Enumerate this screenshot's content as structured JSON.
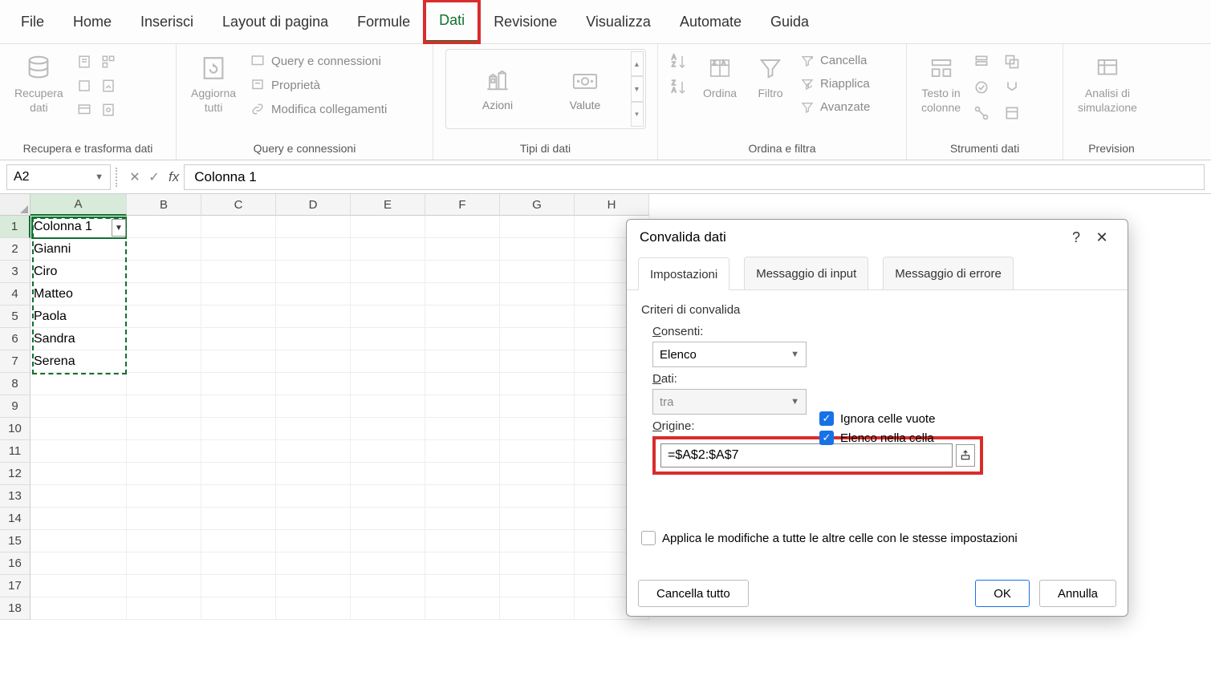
{
  "menu": {
    "items": [
      "File",
      "Home",
      "Inserisci",
      "Layout di pagina",
      "Formule",
      "Dati",
      "Revisione",
      "Visualizza",
      "Automate",
      "Guida"
    ],
    "active": "Dati"
  },
  "ribbon": {
    "groups": {
      "recupera": {
        "label": "Recupera e trasforma dati",
        "btn": "Recupera\ndati"
      },
      "aggiorna": {
        "label": "Query e connessioni",
        "btn": "Aggiorna\ntutti",
        "items": [
          "Query e connessioni",
          "Proprietà",
          "Modifica collegamenti"
        ]
      },
      "tipi": {
        "label": "Tipi di dati",
        "items": [
          "Azioni",
          "Valute"
        ]
      },
      "ordina": {
        "label": "Ordina e filtra",
        "ordina": "Ordina",
        "filtro": "Filtro",
        "side": [
          "Cancella",
          "Riapplica",
          "Avanzate"
        ]
      },
      "strumenti": {
        "label": "Strumenti dati",
        "btn": "Testo in\ncolonne"
      },
      "previsione": {
        "label": "Prevision",
        "btn": "Analisi di\nsimulazione"
      }
    }
  },
  "formula_bar": {
    "name": "A2",
    "fx": "fx",
    "value": "Colonna 1"
  },
  "grid": {
    "cols": [
      "A",
      "B",
      "C",
      "D",
      "E",
      "F",
      "G",
      "H"
    ],
    "rows": 18,
    "a1": "Colonna 1",
    "data": [
      "Gianni",
      "Ciro",
      "Matteo",
      "Paola",
      "Sandra",
      "Serena"
    ]
  },
  "dialog": {
    "title": "Convalida dati",
    "tabs": [
      "Impostazioni",
      "Messaggio di input",
      "Messaggio di errore"
    ],
    "section": "Criteri di convalida",
    "consenti_label": "Consenti:",
    "consenti_value": "Elenco",
    "dati_label": "Dati:",
    "dati_value": "tra",
    "origine_label": "Origine:",
    "origine_value": "=$A$2:$A$7",
    "chk1": "Ignora celle vuote",
    "chk2": "Elenco nella cella",
    "apply_all": "Applica le modifiche a tutte le altre celle con le stesse impostazioni",
    "clear": "Cancella tutto",
    "ok": "OK",
    "cancel": "Annulla"
  }
}
